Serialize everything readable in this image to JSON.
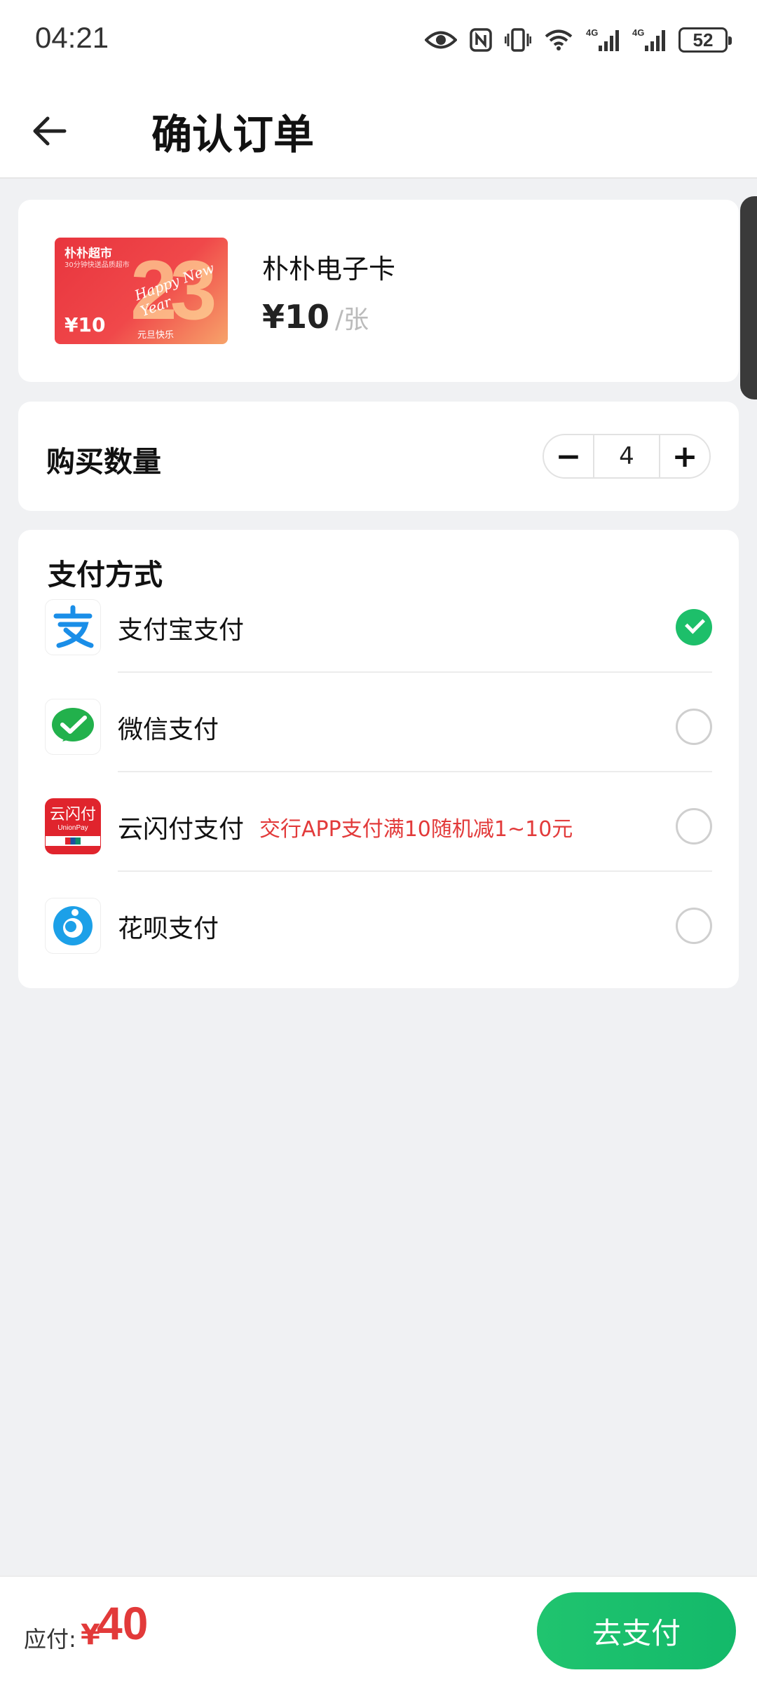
{
  "status_bar": {
    "time": "04:21",
    "battery": "52",
    "icons": [
      "eye-icon",
      "nfc-icon",
      "vibrate-icon",
      "wifi-icon",
      "signal-4g-icon",
      "signal-4g-icon"
    ]
  },
  "header": {
    "title": "确认订单"
  },
  "product": {
    "card_brand": "朴朴超市",
    "card_slogan": "30分钟快送品质超市",
    "card_value": "¥10",
    "card_caption": "元旦快乐",
    "card_big": "23",
    "card_script": "Happy New Year",
    "name": "朴朴电子卡",
    "price": "¥10",
    "unit": "/张"
  },
  "quantity": {
    "label": "购买数量",
    "minus": "−",
    "value": "4",
    "plus": "+"
  },
  "payment": {
    "title": "支付方式",
    "options": [
      {
        "label": "支付宝支付",
        "promo": "",
        "selected": true,
        "icon": "alipay-icon"
      },
      {
        "label": "微信支付",
        "promo": "",
        "selected": false,
        "icon": "wechat-pay-icon"
      },
      {
        "label": "云闪付支付",
        "promo": "交行APP支付满10随机减1~10元",
        "selected": false,
        "icon": "unionpay-icon"
      },
      {
        "label": "花呗支付",
        "promo": "",
        "selected": false,
        "icon": "huabei-icon"
      }
    ],
    "unionpay_logo_top": "云闪付",
    "unionpay_logo_bottom": "UnionPay"
  },
  "footer": {
    "amount_label": "应付:",
    "currency": "¥",
    "amount": "40",
    "pay_button": "去支付"
  },
  "colors": {
    "accent_green": "#1dbf6a",
    "price_red": "#e23a3a"
  }
}
